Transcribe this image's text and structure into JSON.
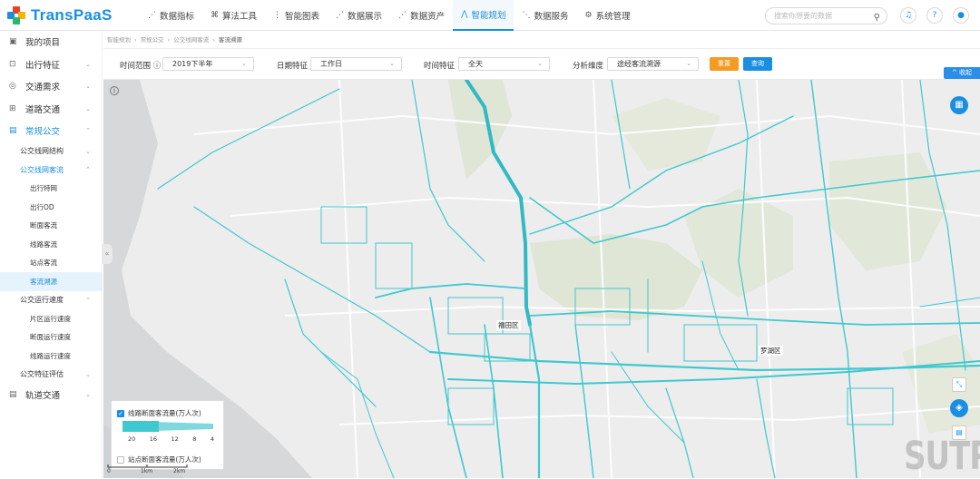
{
  "app": {
    "name": "TransPaaS"
  },
  "nav": [
    {
      "icon": "chart-line-icon",
      "glyph": "⋰",
      "label": "数据指标"
    },
    {
      "icon": "algorithm-icon",
      "glyph": "⌘",
      "label": "算法工具"
    },
    {
      "icon": "smart-chart-icon",
      "glyph": "⋮",
      "label": "智能图表"
    },
    {
      "icon": "display-icon",
      "glyph": "⋰",
      "label": "数据展示"
    },
    {
      "icon": "assets-icon",
      "glyph": "⋰",
      "label": "数据资产"
    },
    {
      "icon": "planning-icon",
      "glyph": "⋀",
      "label": "智能规划"
    },
    {
      "icon": "service-icon",
      "glyph": "⋱",
      "label": "数据服务"
    },
    {
      "icon": "settings-icon",
      "glyph": "⚙",
      "label": "系统管理"
    }
  ],
  "search": {
    "placeholder": "搜索你想要的数据"
  },
  "sidebar": {
    "top": [
      {
        "label": "我的项目",
        "glyph": "▣"
      },
      {
        "label": "出行特征",
        "glyph": "⊡",
        "chevron": "⌄"
      },
      {
        "label": "交通需求",
        "glyph": "◎",
        "chevron": "⌄"
      },
      {
        "label": "道路交通",
        "glyph": "⊞",
        "chevron": "⌄"
      }
    ],
    "group": {
      "label": "常规公交",
      "glyph": "▤",
      "chevron": "⌃"
    },
    "sub1": {
      "label": "公交线网结构",
      "chevron": "⌄"
    },
    "sub2": {
      "label": "公交线网客流",
      "chevron": "⌃"
    },
    "leaves": [
      "出行特网",
      "出行OD",
      "断面客流",
      "线路客流",
      "站点客流",
      "客流溯源"
    ],
    "sub3": {
      "label": "公交运行速度",
      "chevron": "⌃"
    },
    "leaves2": [
      "片区运行速度",
      "断面运行速度",
      "线路运行速度"
    ],
    "sub4": {
      "label": "公交特征评估",
      "chevron": "⌄"
    },
    "last": {
      "label": "轨道交通",
      "glyph": "▤",
      "chevron": "⌄"
    }
  },
  "breadcrumb": [
    "智能规划",
    "常规公交",
    "公交线网客流",
    "客流溯源"
  ],
  "filters": {
    "time_range_label": "时间范围 ⓘ",
    "time_range_value": "2019下半年",
    "date_label": "日期特征",
    "date_value": "工作日",
    "time_label": "时间特征",
    "time_value": "全天",
    "dim_label": "分析维度",
    "dim_value": "途经客流溯源",
    "reset_label": "重置",
    "query_label": "查询",
    "collapse_label": "^ 收起"
  },
  "map": {
    "districts": [
      "福田区",
      "罗湖区"
    ],
    "legend_line_label": "线路断面客流量(万人次)",
    "legend_ticks": [
      "20",
      "16",
      "12",
      "8",
      "4"
    ],
    "legend_stop_label": "站点断面客流量(万人次)",
    "scale": [
      "0",
      "1km",
      "2km"
    ],
    "watermark": "SUTPC"
  },
  "colors": {
    "accent": "#1a8fe0",
    "reset": "#f59a23",
    "flow": "#3fc8cf"
  }
}
